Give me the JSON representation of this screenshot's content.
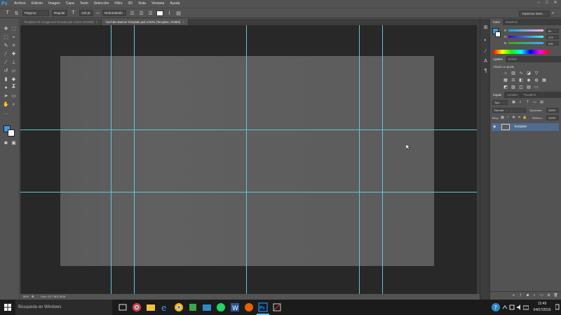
{
  "app": {
    "logo": "Ps",
    "accent": "#31a8ff"
  },
  "menu": [
    "Archivo",
    "Edición",
    "Imagen",
    "Capa",
    "Texto",
    "Selección",
    "Filtro",
    "3D",
    "Vista",
    "Ventana",
    "Ayuda"
  ],
  "window_controls": {
    "minimize": "–",
    "maximize": "□",
    "close": "✕"
  },
  "options_bar": {
    "tool_icon": "text-tool-icon",
    "font_family": "Papyrus",
    "font_style": "Regular",
    "font_size": "140 pt",
    "antialias_label": "aa",
    "antialias": "Redondeado",
    "text_color": "#ffffff",
    "workspace": "Aspectos esen."
  },
  "tabs": [
    {
      "label": "Template Ple Gosgina El Teclado.psd al 50% (RGB/8)",
      "active": false
    },
    {
      "label": "YouTube Banner Template.psd al 50% (Template, RGB/8)",
      "active": true
    }
  ],
  "status": {
    "zoom": "50%",
    "doc_size": "Doc: 10,7 M/1,36 M"
  },
  "colors": {
    "foreground": "#3d9ad7",
    "background": "#ffffff",
    "guide": "#63c6d6",
    "canvas": "#5e5e5e"
  },
  "color_panel": {
    "tabs": [
      "Color",
      "Muestras"
    ],
    "sliders": [
      {
        "letter": "R",
        "value": "61"
      },
      {
        "letter": "G",
        "value": "172"
      },
      {
        "letter": "B",
        "value": "230"
      }
    ]
  },
  "adjust_panel": {
    "tabs": [
      "Ajustes",
      "Estilos"
    ],
    "title": "Añadir un ajuste"
  },
  "layers_panel": {
    "tabs": [
      "Capas",
      "Canales",
      "Trazados"
    ],
    "filter_kind": "Tipo",
    "blend_mode": "Normal",
    "opacity_label": "Opacidad:",
    "opacity": "100%",
    "lock_label": "Bloq.:",
    "fill_label": "Relleno:",
    "fill": "100%",
    "layers": [
      {
        "name": "Template",
        "selected": true
      }
    ]
  },
  "taskbar": {
    "search_placeholder": "Búsqueda en Windows",
    "time": "12:49",
    "date": "04/07/2016"
  }
}
